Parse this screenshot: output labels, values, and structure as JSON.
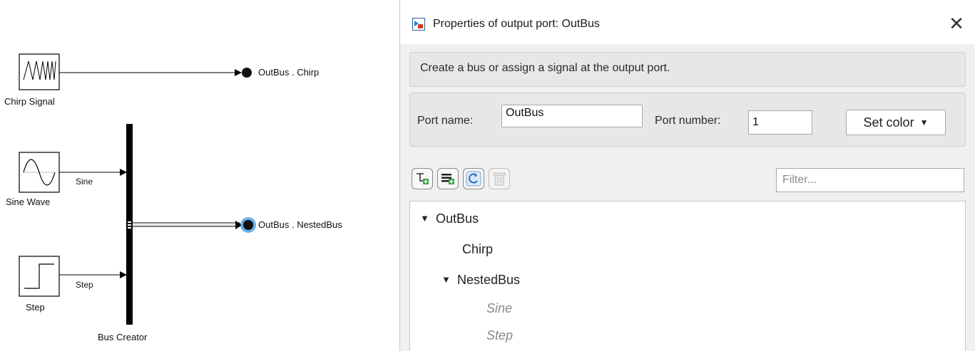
{
  "canvas": {
    "blocks": {
      "chirp": "Chirp Signal",
      "sine": "Sine Wave",
      "step": "Step",
      "bus_creator": "Bus Creator"
    },
    "signals": {
      "sine": "Sine",
      "step": "Step"
    },
    "ports": {
      "chirp": "OutBus . Chirp",
      "nested": "OutBus . NestedBus"
    },
    "highlight_color": "#4aa3e6"
  },
  "dialog": {
    "title": "Properties of output port: OutBus",
    "description": "Create a bus or assign a signal at the output port.",
    "port_name_label": "Port name:",
    "port_name_value": "OutBus",
    "port_number_label": "Port number:",
    "port_number_value": "1",
    "set_color_label": "Set color",
    "toolbar": {
      "icons": [
        "add-signal-icon",
        "add-bus-icon",
        "refresh-icon",
        "delete-icon"
      ]
    },
    "filter_placeholder": "Filter...",
    "tree": {
      "root": "OutBus",
      "chirp": "Chirp",
      "nested": "NestedBus",
      "sine": "Sine",
      "step": "Step"
    }
  }
}
